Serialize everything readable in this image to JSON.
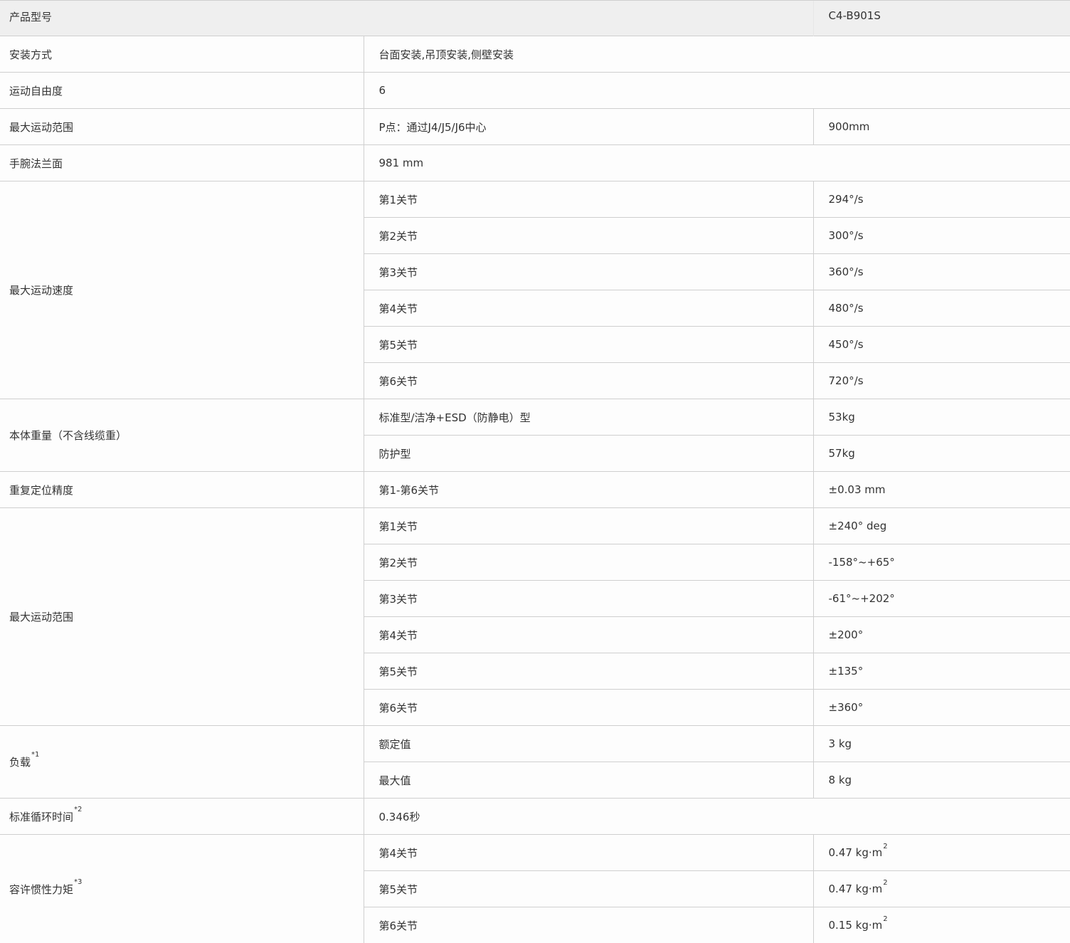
{
  "header": {
    "label": "产品型号",
    "model": "C4-B901S"
  },
  "mounting": {
    "label": "安装方式",
    "value": "台面安装,吊顶安装,侧壁安装"
  },
  "dof": {
    "label": "运动自由度",
    "value": "6"
  },
  "reach": {
    "label": "最大运动范围",
    "point_label": "P点：通过J4/J5/J6中心",
    "point_value": "900mm"
  },
  "flange": {
    "label": "手腕法兰面",
    "value": "981 mm"
  },
  "speed": {
    "label": "最大运动速度",
    "rows": [
      {
        "joint": "第1关节",
        "value": "294°/s"
      },
      {
        "joint": "第2关节",
        "value": "300°/s"
      },
      {
        "joint": "第3关节",
        "value": "360°/s"
      },
      {
        "joint": "第4关节",
        "value": "480°/s"
      },
      {
        "joint": "第5关节",
        "value": "450°/s"
      },
      {
        "joint": "第6关节",
        "value": "720°/s"
      }
    ]
  },
  "weight": {
    "label": "本体重量（不含线缆重）",
    "rows": [
      {
        "type": "标准型/洁净+ESD（防静电）型",
        "value": "53kg"
      },
      {
        "type": "防护型",
        "value": "57kg"
      }
    ]
  },
  "repeat": {
    "label": "重复定位精度",
    "joints": "第1-第6关节",
    "value": "±0.03 mm"
  },
  "range": {
    "label": "最大运动范围",
    "rows": [
      {
        "joint": "第1关节",
        "value": "±240° deg"
      },
      {
        "joint": "第2关节",
        "value": "-158°~+65°"
      },
      {
        "joint": "第3关节",
        "value": "-61°~+202°"
      },
      {
        "joint": "第4关节",
        "value": "±200°"
      },
      {
        "joint": "第5关节",
        "value": "±135°"
      },
      {
        "joint": "第6关节",
        "value": "±360°"
      }
    ]
  },
  "payload": {
    "label": "负载",
    "note": "*1",
    "rows": [
      {
        "type": "额定值",
        "value": "3 kg"
      },
      {
        "type": "最大值",
        "value": "8 kg"
      }
    ]
  },
  "cycle": {
    "label": "标准循环时间",
    "note": "*2",
    "value": "0.346秒"
  },
  "inertia": {
    "label": "容许惯性力矩",
    "note": "*3",
    "unit_sup": "2",
    "rows": [
      {
        "joint": "第4关节",
        "value": "0.47 kg·m"
      },
      {
        "joint": "第5关节",
        "value": "0.47 kg·m"
      },
      {
        "joint": "第6关节",
        "value": "0.15 kg·m"
      }
    ]
  }
}
